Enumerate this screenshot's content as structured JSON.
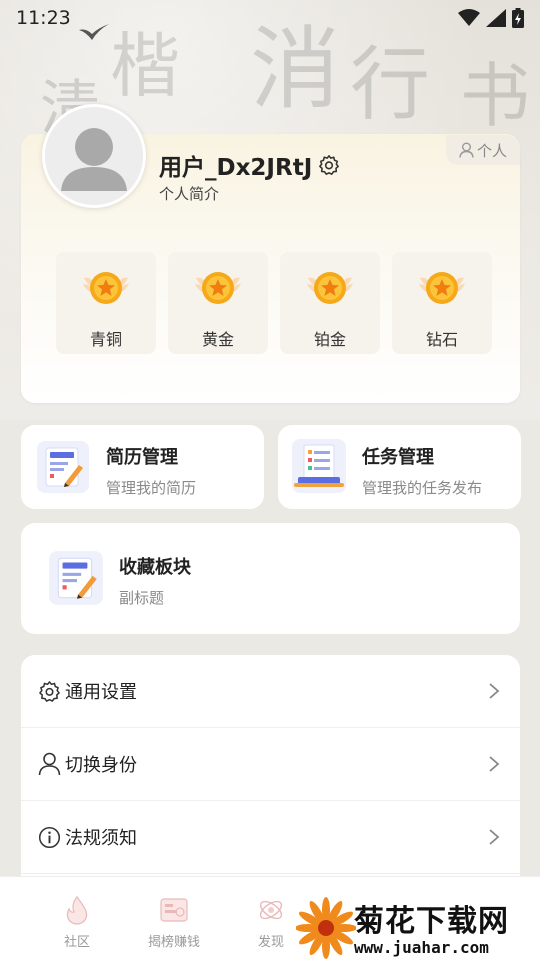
{
  "status_bar": {
    "time": "11:23"
  },
  "profile": {
    "username": "用户_Dx2JRtJ",
    "bio": "个人简介",
    "role_tag": "个人",
    "tiers": [
      {
        "label": "青铜",
        "icon": "medal-icon"
      },
      {
        "label": "黄金",
        "icon": "medal-icon"
      },
      {
        "label": "铂金",
        "icon": "medal-icon"
      },
      {
        "label": "钻石",
        "icon": "medal-icon"
      }
    ]
  },
  "features": {
    "resume": {
      "title": "简历管理",
      "subtitle": "管理我的简历",
      "icon": "resume-document-icon"
    },
    "tasks": {
      "title": "任务管理",
      "subtitle": "管理我的任务发布",
      "icon": "task-laptop-icon"
    },
    "favorites": {
      "title": "收藏板块",
      "subtitle": "副标题",
      "icon": "favorites-document-icon"
    }
  },
  "settings": [
    {
      "label": "通用设置",
      "icon": "gear-icon"
    },
    {
      "label": "切换身份",
      "icon": "user-icon"
    },
    {
      "label": "法规须知",
      "icon": "info-icon"
    }
  ],
  "bottom_nav": [
    {
      "label": "社区",
      "icon": "community-flame-icon"
    },
    {
      "label": "揭榜赚钱",
      "icon": "bounty-card-icon"
    },
    {
      "label": "发现",
      "icon": "discover-orbit-icon"
    }
  ],
  "watermark": {
    "title": "菊花下载网",
    "url": "www.juahar.com"
  },
  "colors": {
    "gold": "#f6b21a",
    "accent_blue": "#5b6ee1",
    "text_primary": "#222222",
    "text_secondary": "#8a8a8a"
  }
}
